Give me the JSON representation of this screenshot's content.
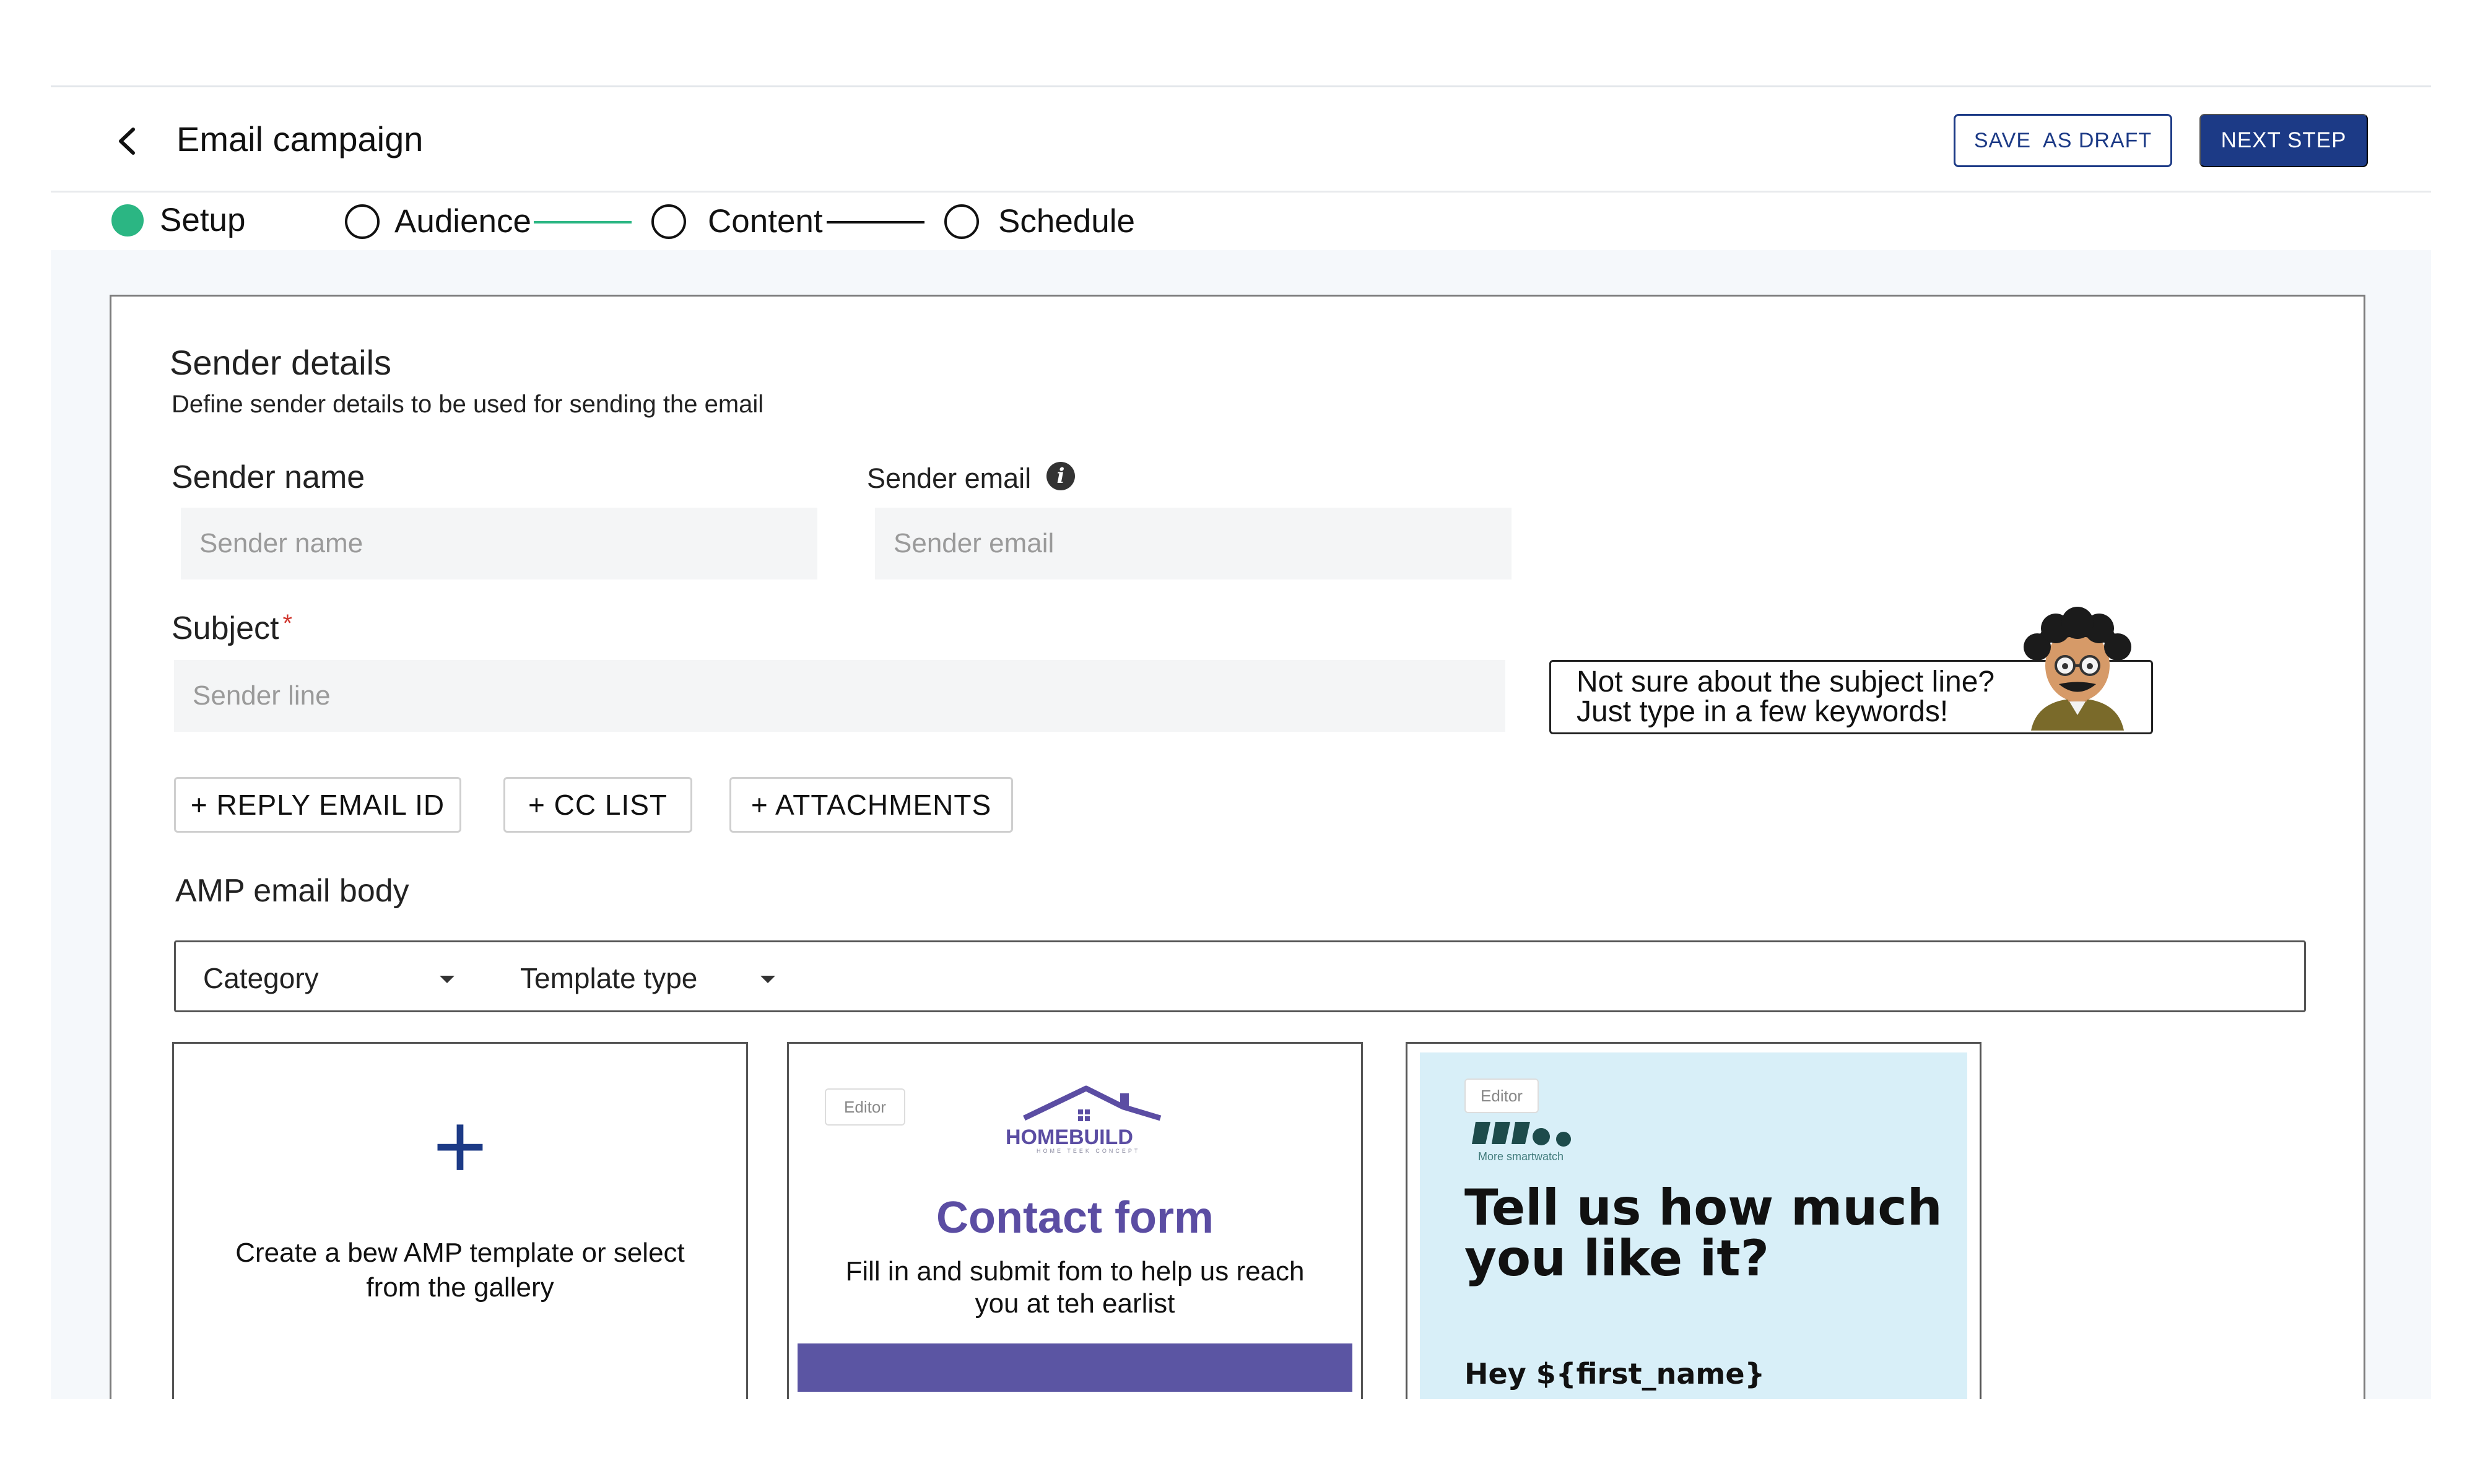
{
  "header": {
    "title": "Email campaign",
    "save_draft_label": "SAVE  AS DRAFT",
    "next_step_label": "NEXT STEP"
  },
  "steps": [
    {
      "label": "Setup",
      "state": "done"
    },
    {
      "label": "Audience",
      "state": "pending"
    },
    {
      "label": "Content",
      "state": "pending"
    },
    {
      "label": "Schedule",
      "state": "pending"
    }
  ],
  "sender_details": {
    "title": "Sender details",
    "subtitle": "Define sender details to be used for sending the email",
    "name_label": "Sender name",
    "name_placeholder": "Sender name",
    "email_label": "Sender email",
    "email_placeholder": "Sender email",
    "subject_label": "Subject",
    "subject_required": "*",
    "subject_placeholder": "Sender line"
  },
  "tip": {
    "line1": "Not sure about the subject line?",
    "line2": "Just type in a few keywords!"
  },
  "chips": {
    "reply": "+ REPLY EMAIL ID",
    "cc": "+ CC LIST",
    "attachments": "+ ATTACHMENTS"
  },
  "amp": {
    "title": "AMP email body",
    "category_label": "Category",
    "template_type_label": "Template type"
  },
  "templates": {
    "create": {
      "plus": "+",
      "line1": "Create a bew AMP template or select",
      "line2": "from the gallery"
    },
    "contact": {
      "tag": "Editor",
      "logo_text": "HOMEBUILD",
      "logo_tagline": "HOME TEEK CONCEPT",
      "title": "Contact form",
      "line1": "Fill in and submit fom to help us reach",
      "line2": "you at teh earlist"
    },
    "feedback": {
      "tag": "Editor",
      "small": "More smartwatch",
      "head1": "Tell us how much",
      "head2": "you like it?",
      "hey": "Hey ${first_name}"
    }
  },
  "colors": {
    "primary": "#1c3a86",
    "step_done": "#2bb683",
    "brand_purple": "#5b4da3",
    "template_bg": "#d8eff8"
  }
}
